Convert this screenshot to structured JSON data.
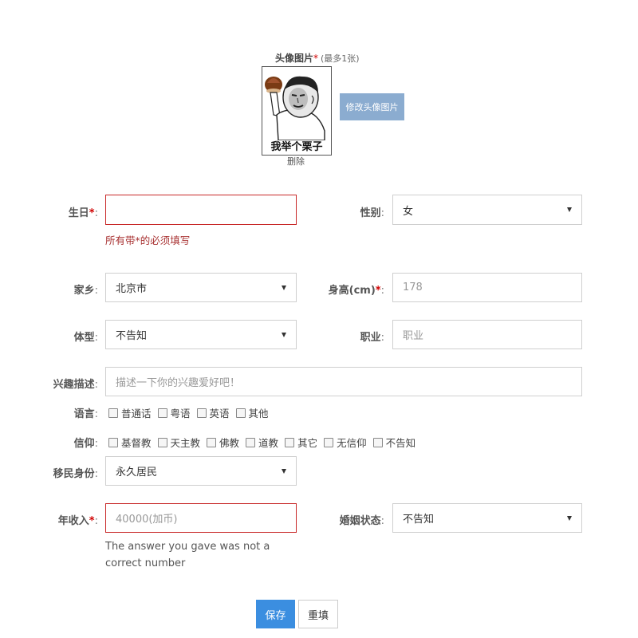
{
  "avatar": {
    "label": "头像图片",
    "required_mark": "*",
    "hint": "(最多1张)",
    "caption": "我举个栗子",
    "delete_label": "删除",
    "change_button": "修改头像图片"
  },
  "fields": {
    "birthday": {
      "label": "生日",
      "required_mark": "*",
      "colon": ":",
      "value": "",
      "error": "所有带*的必须填写"
    },
    "gender": {
      "label": "性别",
      "colon": ":",
      "value": "女"
    },
    "hometown": {
      "label": "家乡",
      "colon": ":",
      "value": "北京市"
    },
    "height": {
      "label": "身高(cm)",
      "required_mark": "*",
      "colon": ":",
      "placeholder": "178"
    },
    "body_type": {
      "label": "体型",
      "colon": ":",
      "value": "不告知"
    },
    "occupation": {
      "label": "职业",
      "colon": ":",
      "placeholder": "职业"
    },
    "interests": {
      "label": "兴趣描述",
      "colon": ":",
      "placeholder": "描述一下你的兴趣爱好吧！"
    },
    "languages": {
      "label": "语言",
      "colon": ":",
      "options": [
        "普通话",
        "粤语",
        "英语",
        "其他"
      ]
    },
    "religion": {
      "label": "信仰",
      "colon": ":",
      "options": [
        "基督教",
        "天主教",
        "佛教",
        "道教",
        "其它",
        "无信仰",
        "不告知"
      ]
    },
    "immigration": {
      "label": "移民身份",
      "colon": ":",
      "value": "永久居民"
    },
    "income": {
      "label": "年收入",
      "required_mark": "*",
      "colon": ":",
      "placeholder": "40000(加币)",
      "error": "The answer you gave was not a correct number"
    },
    "marital": {
      "label": "婚姻状态",
      "colon": ":",
      "value": "不告知"
    }
  },
  "buttons": {
    "save": "保存",
    "reset": "重填"
  },
  "colors": {
    "primary": "#3b8ee0",
    "avatar_button": "#8bacd0",
    "error_border": "#c82828",
    "required": "#d00000"
  }
}
